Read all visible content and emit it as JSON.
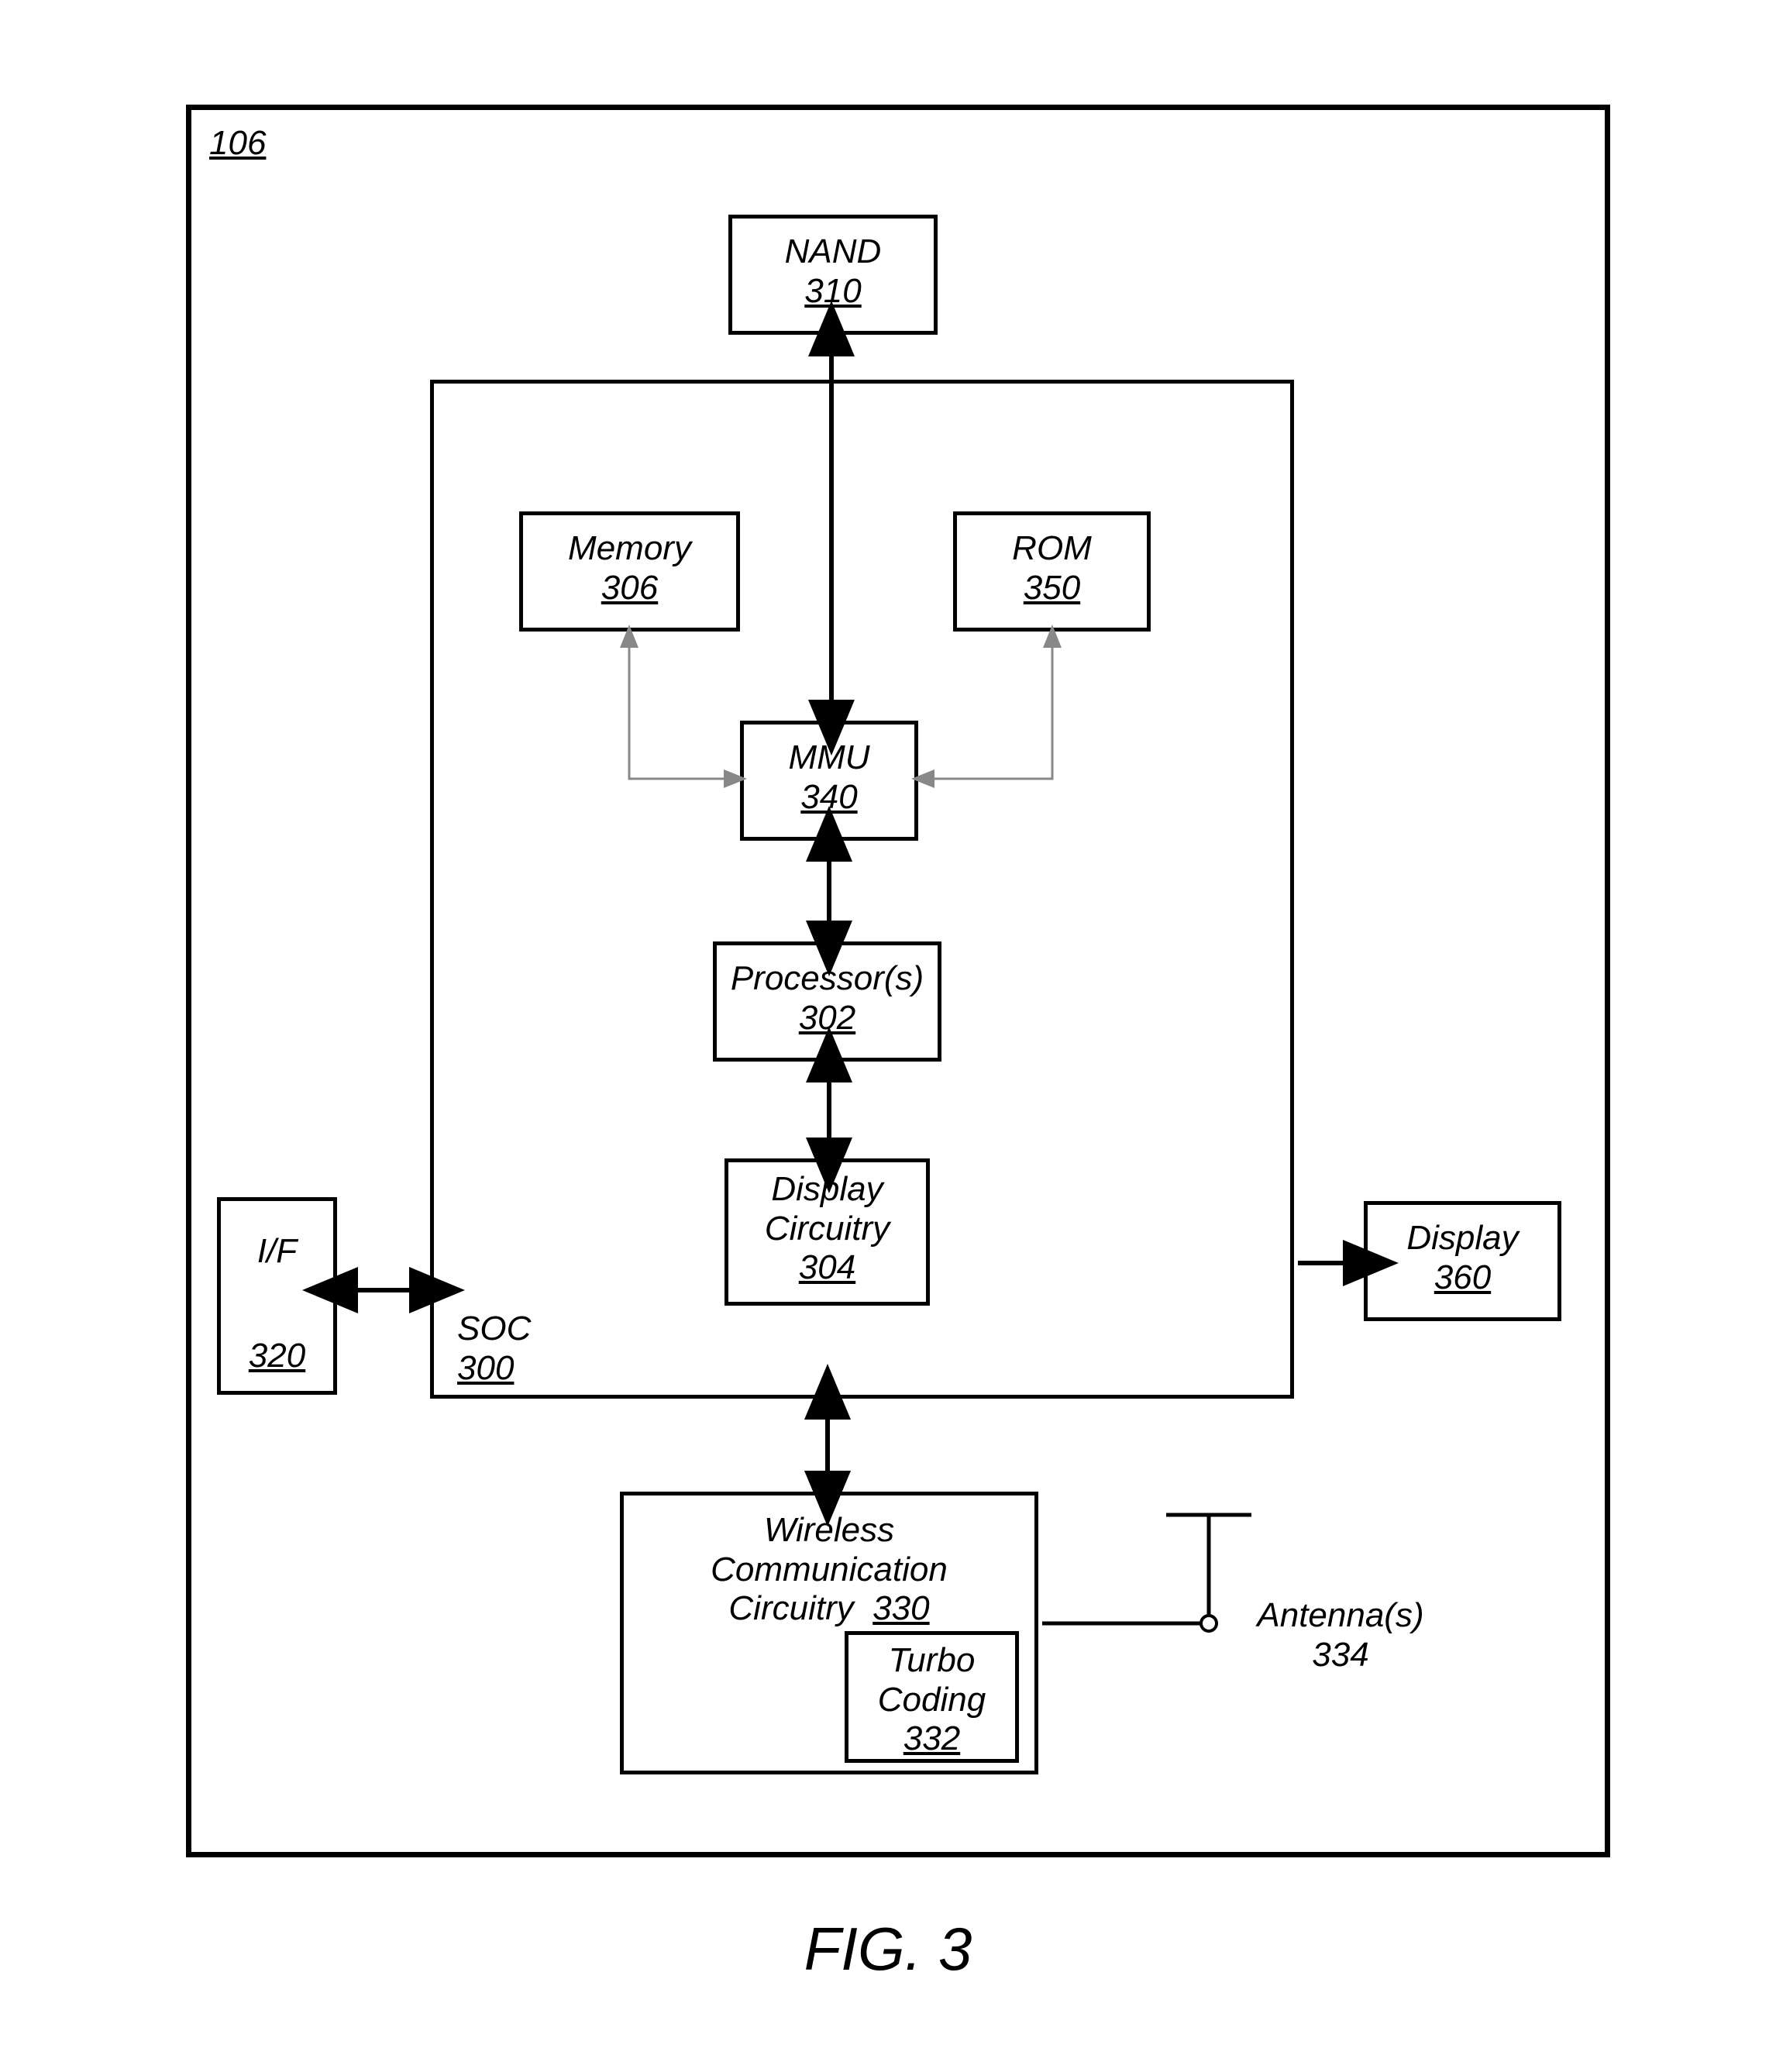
{
  "outer_ref": "106",
  "figure_caption": "FIG. 3",
  "blocks": {
    "nand": {
      "label": "NAND",
      "ref": "310"
    },
    "memory": {
      "label": "Memory",
      "ref": "306"
    },
    "rom": {
      "label": "ROM",
      "ref": "350"
    },
    "mmu": {
      "label": "MMU",
      "ref": "340"
    },
    "processor": {
      "label": "Processor(s)",
      "ref": "302"
    },
    "display_circ": {
      "label": "Display\nCircuitry",
      "ref": "304"
    },
    "if": {
      "label": "I/F",
      "ref": "320"
    },
    "display": {
      "label": "Display",
      "ref": "360"
    },
    "wireless": {
      "label": "Wireless\nCommunication\nCircuitry",
      "ref": "330"
    },
    "turbo": {
      "label": "Turbo\nCoding",
      "ref": "332"
    },
    "antenna": {
      "label": "Antenna(s)",
      "ref": "334"
    },
    "soc": {
      "label": "SOC",
      "ref": "300"
    }
  }
}
